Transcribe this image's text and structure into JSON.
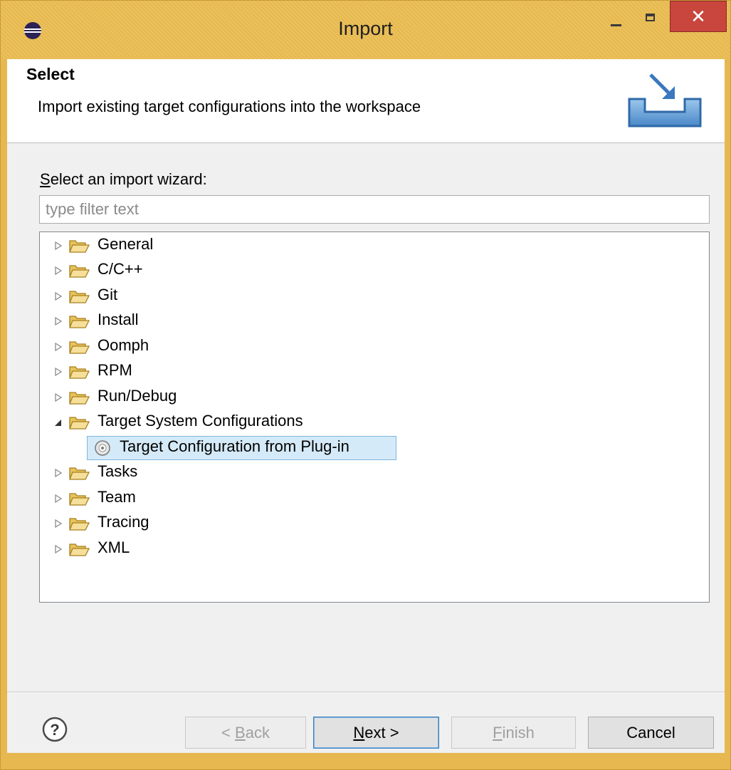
{
  "window": {
    "title": "Import",
    "close_glyph": "✕"
  },
  "header": {
    "title": "Select",
    "description": "Import existing target configurations into the workspace"
  },
  "wizard": {
    "label_mnemonic": "S",
    "label_rest": "elect an import wizard:",
    "filter_placeholder": "type filter text",
    "filter_value": ""
  },
  "tree": {
    "items": [
      {
        "label": "General",
        "expanded": false
      },
      {
        "label": "C/C++",
        "expanded": false
      },
      {
        "label": "Git",
        "expanded": false
      },
      {
        "label": "Install",
        "expanded": false
      },
      {
        "label": "Oomph",
        "expanded": false
      },
      {
        "label": "RPM",
        "expanded": false
      },
      {
        "label": "Run/Debug",
        "expanded": false
      },
      {
        "label": "Target System Configurations",
        "expanded": true
      },
      {
        "label": "Target Configuration from Plug-in",
        "child": true,
        "selected": true
      },
      {
        "label": "Tasks",
        "expanded": false
      },
      {
        "label": "Team",
        "expanded": false
      },
      {
        "label": "Tracing",
        "expanded": false
      },
      {
        "label": "XML",
        "expanded": false
      }
    ]
  },
  "buttons": {
    "help_glyph": "?",
    "back_prefix": "< ",
    "back_mnemonic": "B",
    "back_rest": "ack",
    "next_mnemonic": "N",
    "next_rest": "ext >",
    "finish_mnemonic": "F",
    "finish_rest": "inish",
    "cancel": "Cancel"
  },
  "colors": {
    "titlebar": "#e6b850",
    "close_button": "#c8463d",
    "selection": "#d5eaf8",
    "folder": "#e8c25a"
  }
}
